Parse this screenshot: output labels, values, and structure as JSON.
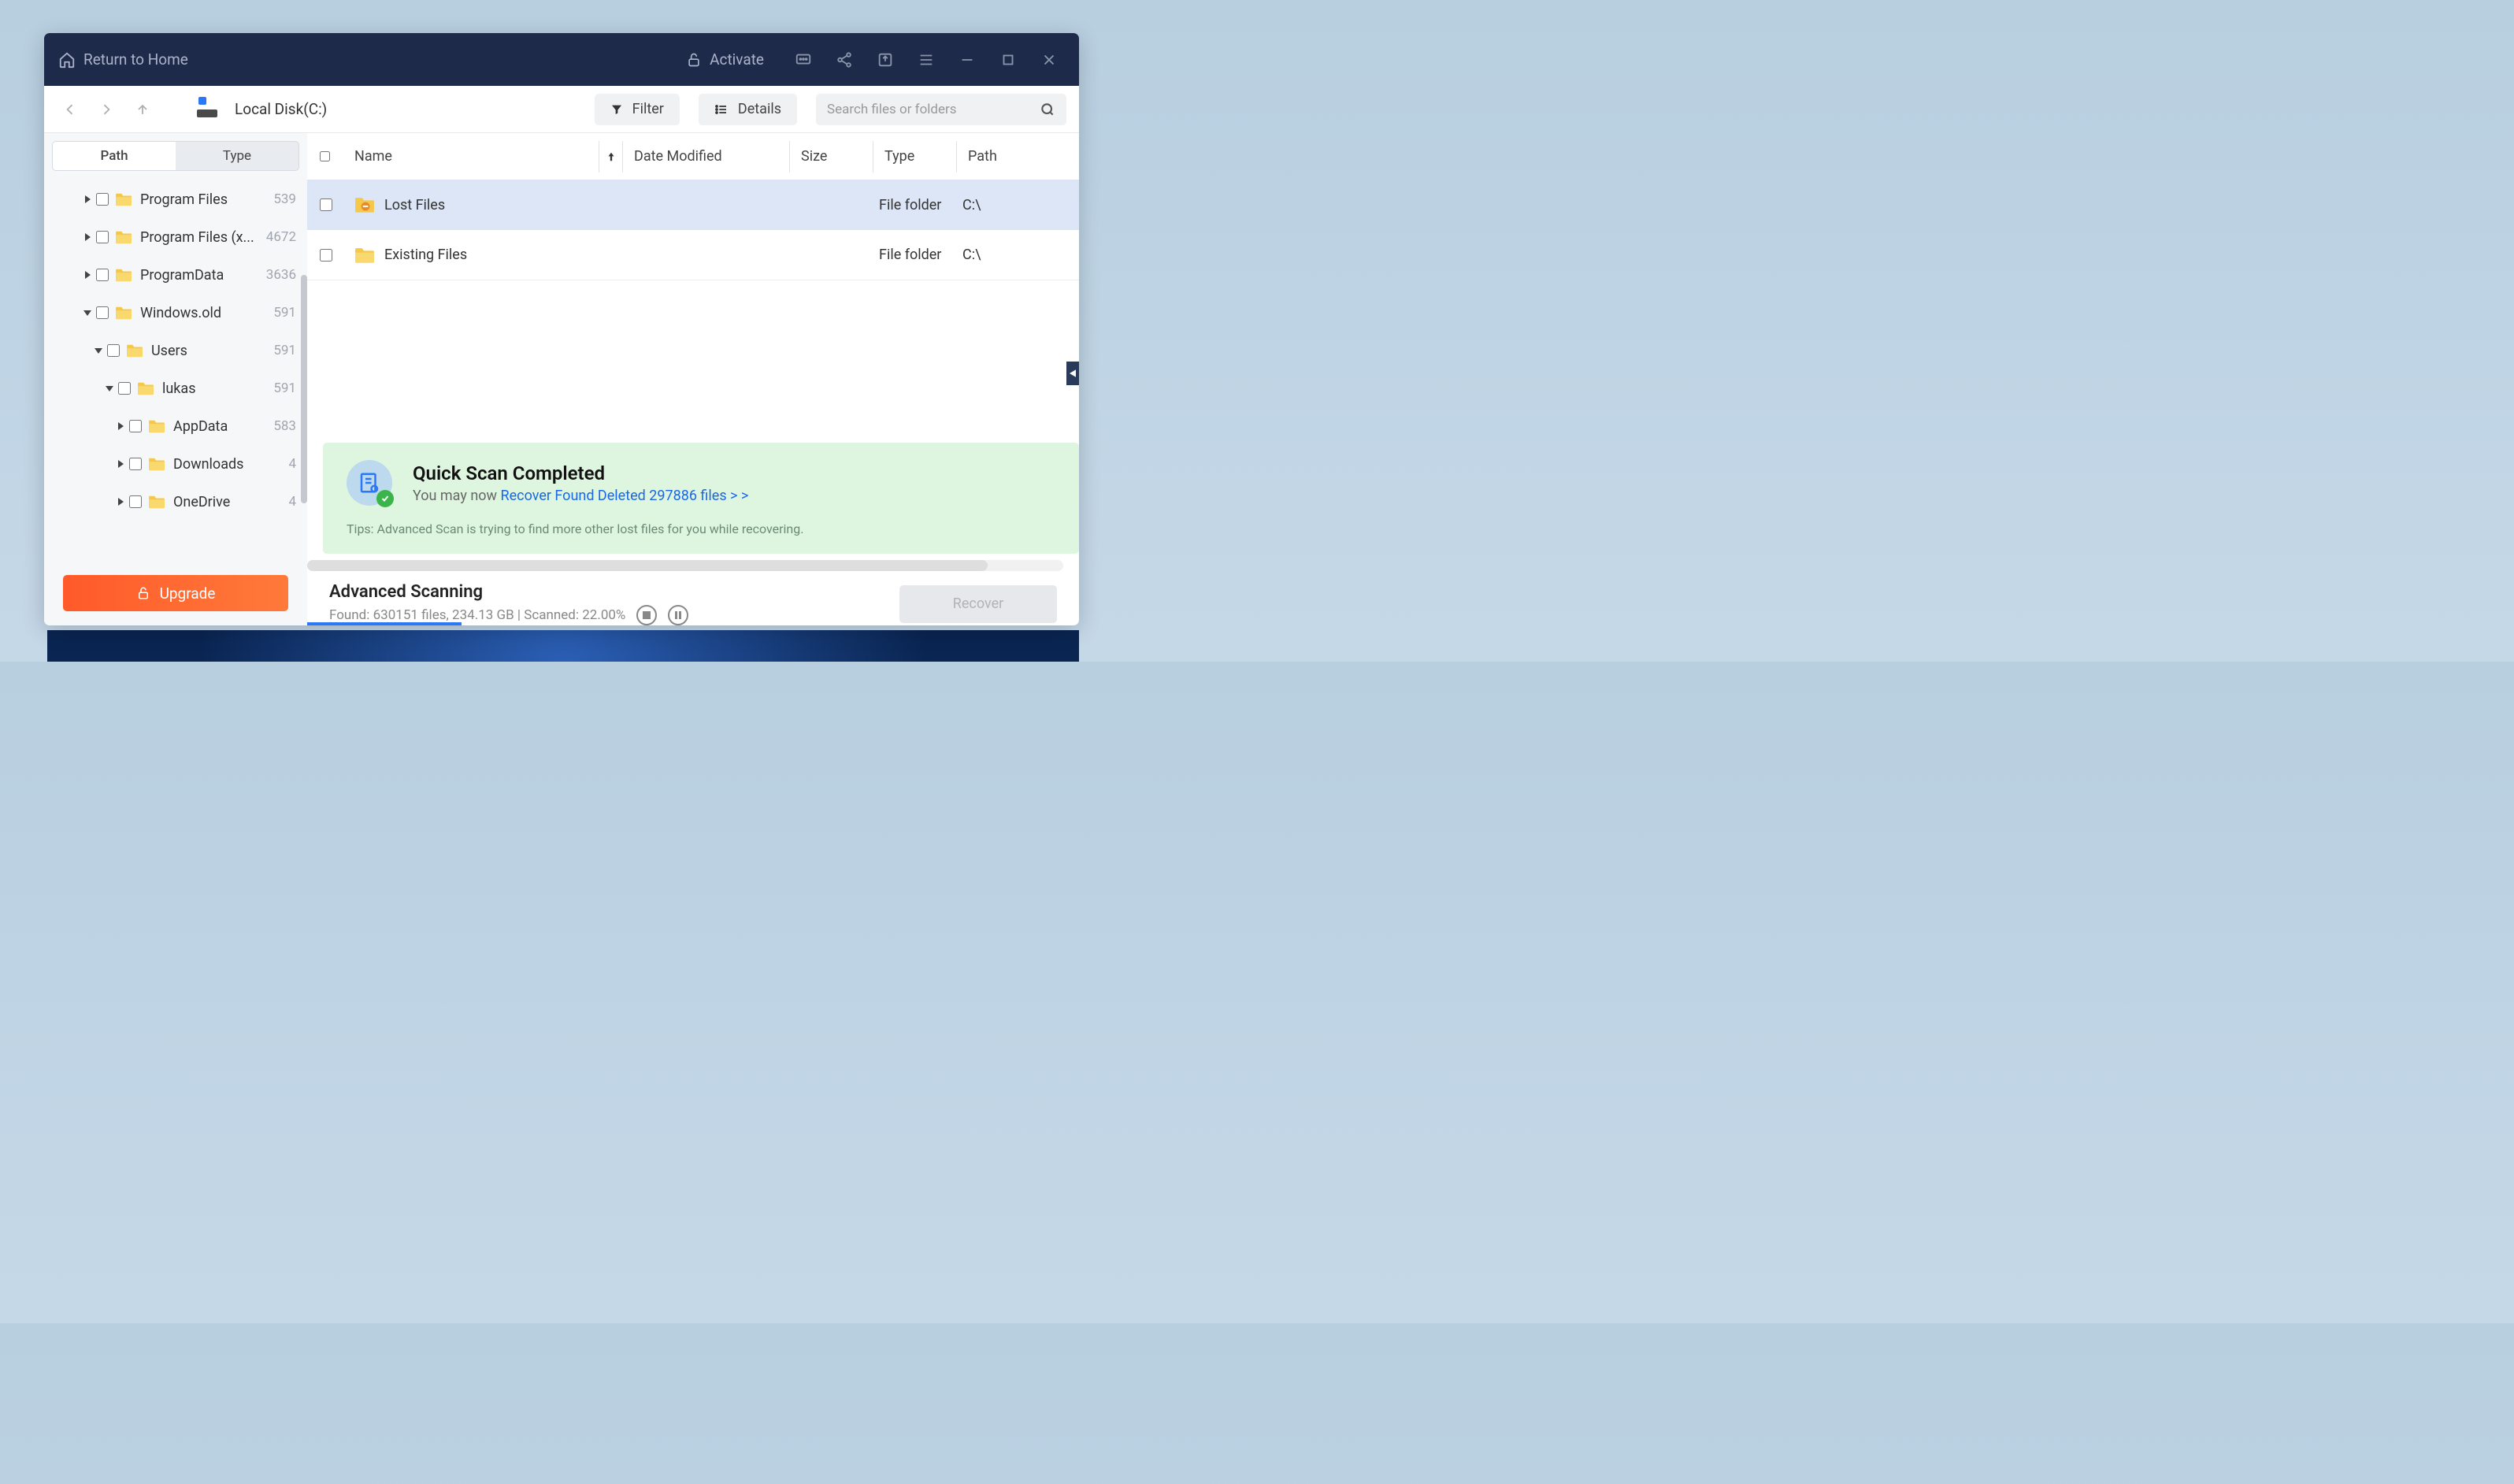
{
  "titlebar": {
    "return_home": "Return to Home",
    "activate": "Activate"
  },
  "toolbar": {
    "breadcrumb": "Local Disk(C:)",
    "filter_label": "Filter",
    "details_label": "Details",
    "search_placeholder": "Search files or folders"
  },
  "sidebar": {
    "tabs": {
      "path": "Path",
      "type": "Type"
    },
    "tree": [
      {
        "label": "Program Files",
        "count": "539",
        "depth": 0,
        "expanded": false
      },
      {
        "label": "Program Files (x...",
        "count": "4672",
        "depth": 0,
        "expanded": false
      },
      {
        "label": "ProgramData",
        "count": "3636",
        "depth": 0,
        "expanded": false
      },
      {
        "label": "Windows.old",
        "count": "591",
        "depth": 0,
        "expanded": true
      },
      {
        "label": "Users",
        "count": "591",
        "depth": 1,
        "expanded": true
      },
      {
        "label": "lukas",
        "count": "591",
        "depth": 2,
        "expanded": true
      },
      {
        "label": "AppData",
        "count": "583",
        "depth": 3,
        "expanded": false
      },
      {
        "label": "Downloads",
        "count": "4",
        "depth": 3,
        "expanded": false
      },
      {
        "label": "OneDrive",
        "count": "4",
        "depth": 3,
        "expanded": false
      }
    ],
    "upgrade_label": "Upgrade"
  },
  "table": {
    "headers": {
      "name": "Name",
      "date": "Date Modified",
      "size": "Size",
      "type": "Type",
      "path": "Path"
    },
    "rows": [
      {
        "name": "Lost Files",
        "date": "",
        "size": "",
        "type": "File folder",
        "path": "C:\\",
        "icon": "lost",
        "selected": true
      },
      {
        "name": "Existing Files",
        "date": "",
        "size": "",
        "type": "File folder",
        "path": "C:\\",
        "icon": "folder",
        "selected": false
      }
    ]
  },
  "panel": {
    "title": "Quick Scan Completed",
    "subtitle_prefix": "You may now ",
    "subtitle_link": "Recover Found Deleted 297886 files > >",
    "tips": "Tips: Advanced Scan is trying to find more other lost files for you while recovering."
  },
  "footer": {
    "title": "Advanced Scanning",
    "stats": "Found: 630151 files, 234.13 GB  |  Scanned: 22.00%",
    "recover_label": "Recover",
    "progress_percent": 22
  }
}
